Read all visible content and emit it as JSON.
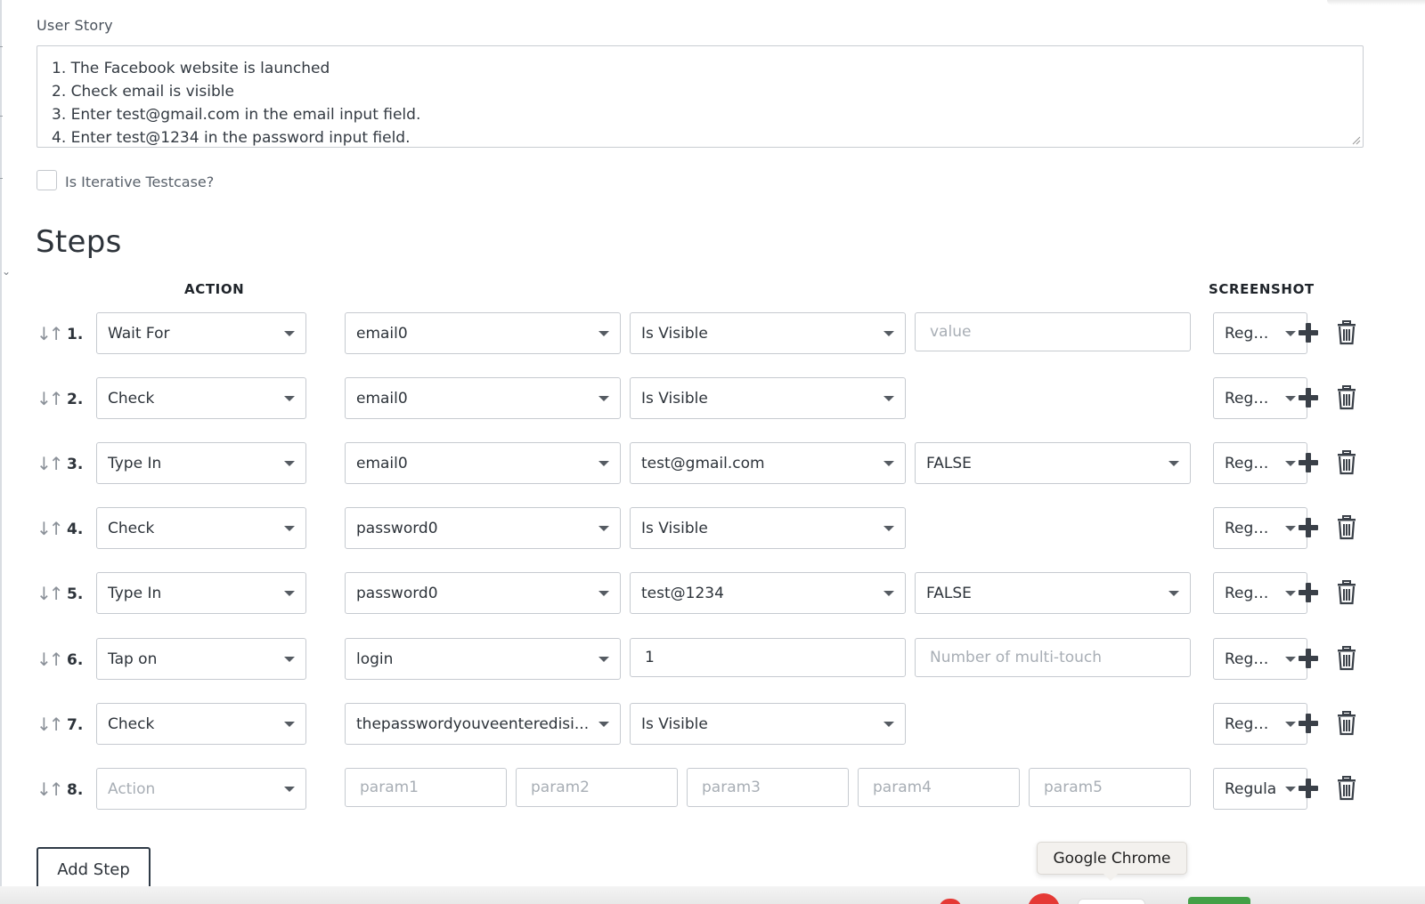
{
  "user_story": {
    "label": "User Story",
    "lines": [
      "1. The Facebook website is launched",
      "2. Check email is visible",
      "3. Enter test@gmail.com in the email input field.",
      "4. Enter test@1234 in the password input field."
    ]
  },
  "iterative": {
    "label": "Is Iterative Testcase?",
    "checked": false
  },
  "steps_title": "Steps",
  "columns": {
    "action": "ACTION",
    "screenshot": "SCREENSHOT"
  },
  "steps": [
    {
      "num": "1.",
      "action": "Wait For",
      "p1": "email0",
      "p2": "Is Visible",
      "p3_placeholder": "value",
      "screenshot": "Regul..."
    },
    {
      "num": "2.",
      "action": "Check",
      "p1": "email0",
      "p2": "Is Visible",
      "screenshot": "Regul..."
    },
    {
      "num": "3.",
      "action": "Type In",
      "p1": "email0",
      "p2": "test@gmail.com",
      "p3": "FALSE",
      "screenshot": "Regul..."
    },
    {
      "num": "4.",
      "action": "Check",
      "p1": "password0",
      "p2": "Is Visible",
      "screenshot": "Regul..."
    },
    {
      "num": "5.",
      "action": "Type In",
      "p1": "password0",
      "p2": "test@1234",
      "p3": "FALSE",
      "screenshot": "Regul..."
    },
    {
      "num": "6.",
      "action": "Tap on",
      "p1": "login",
      "p2_input": "1",
      "p3_placeholder": "Number of multi-touch",
      "screenshot": "Regul..."
    },
    {
      "num": "7.",
      "action": "Check",
      "p1": "thepasswordyouveenteredisi...",
      "p2": "Is Visible",
      "screenshot": "Regul..."
    },
    {
      "num": "8.",
      "action_placeholder": "Action",
      "params": [
        "param1",
        "param2",
        "param3",
        "param4",
        "param5"
      ],
      "screenshot": "Regula"
    }
  ],
  "add_step": "Add Step",
  "tooltip": "Google Chrome",
  "icons": {
    "drag": "sort-arrows-icon",
    "add": "plus-icon",
    "delete": "trash-icon",
    "dropdown": "caret-down-icon"
  }
}
